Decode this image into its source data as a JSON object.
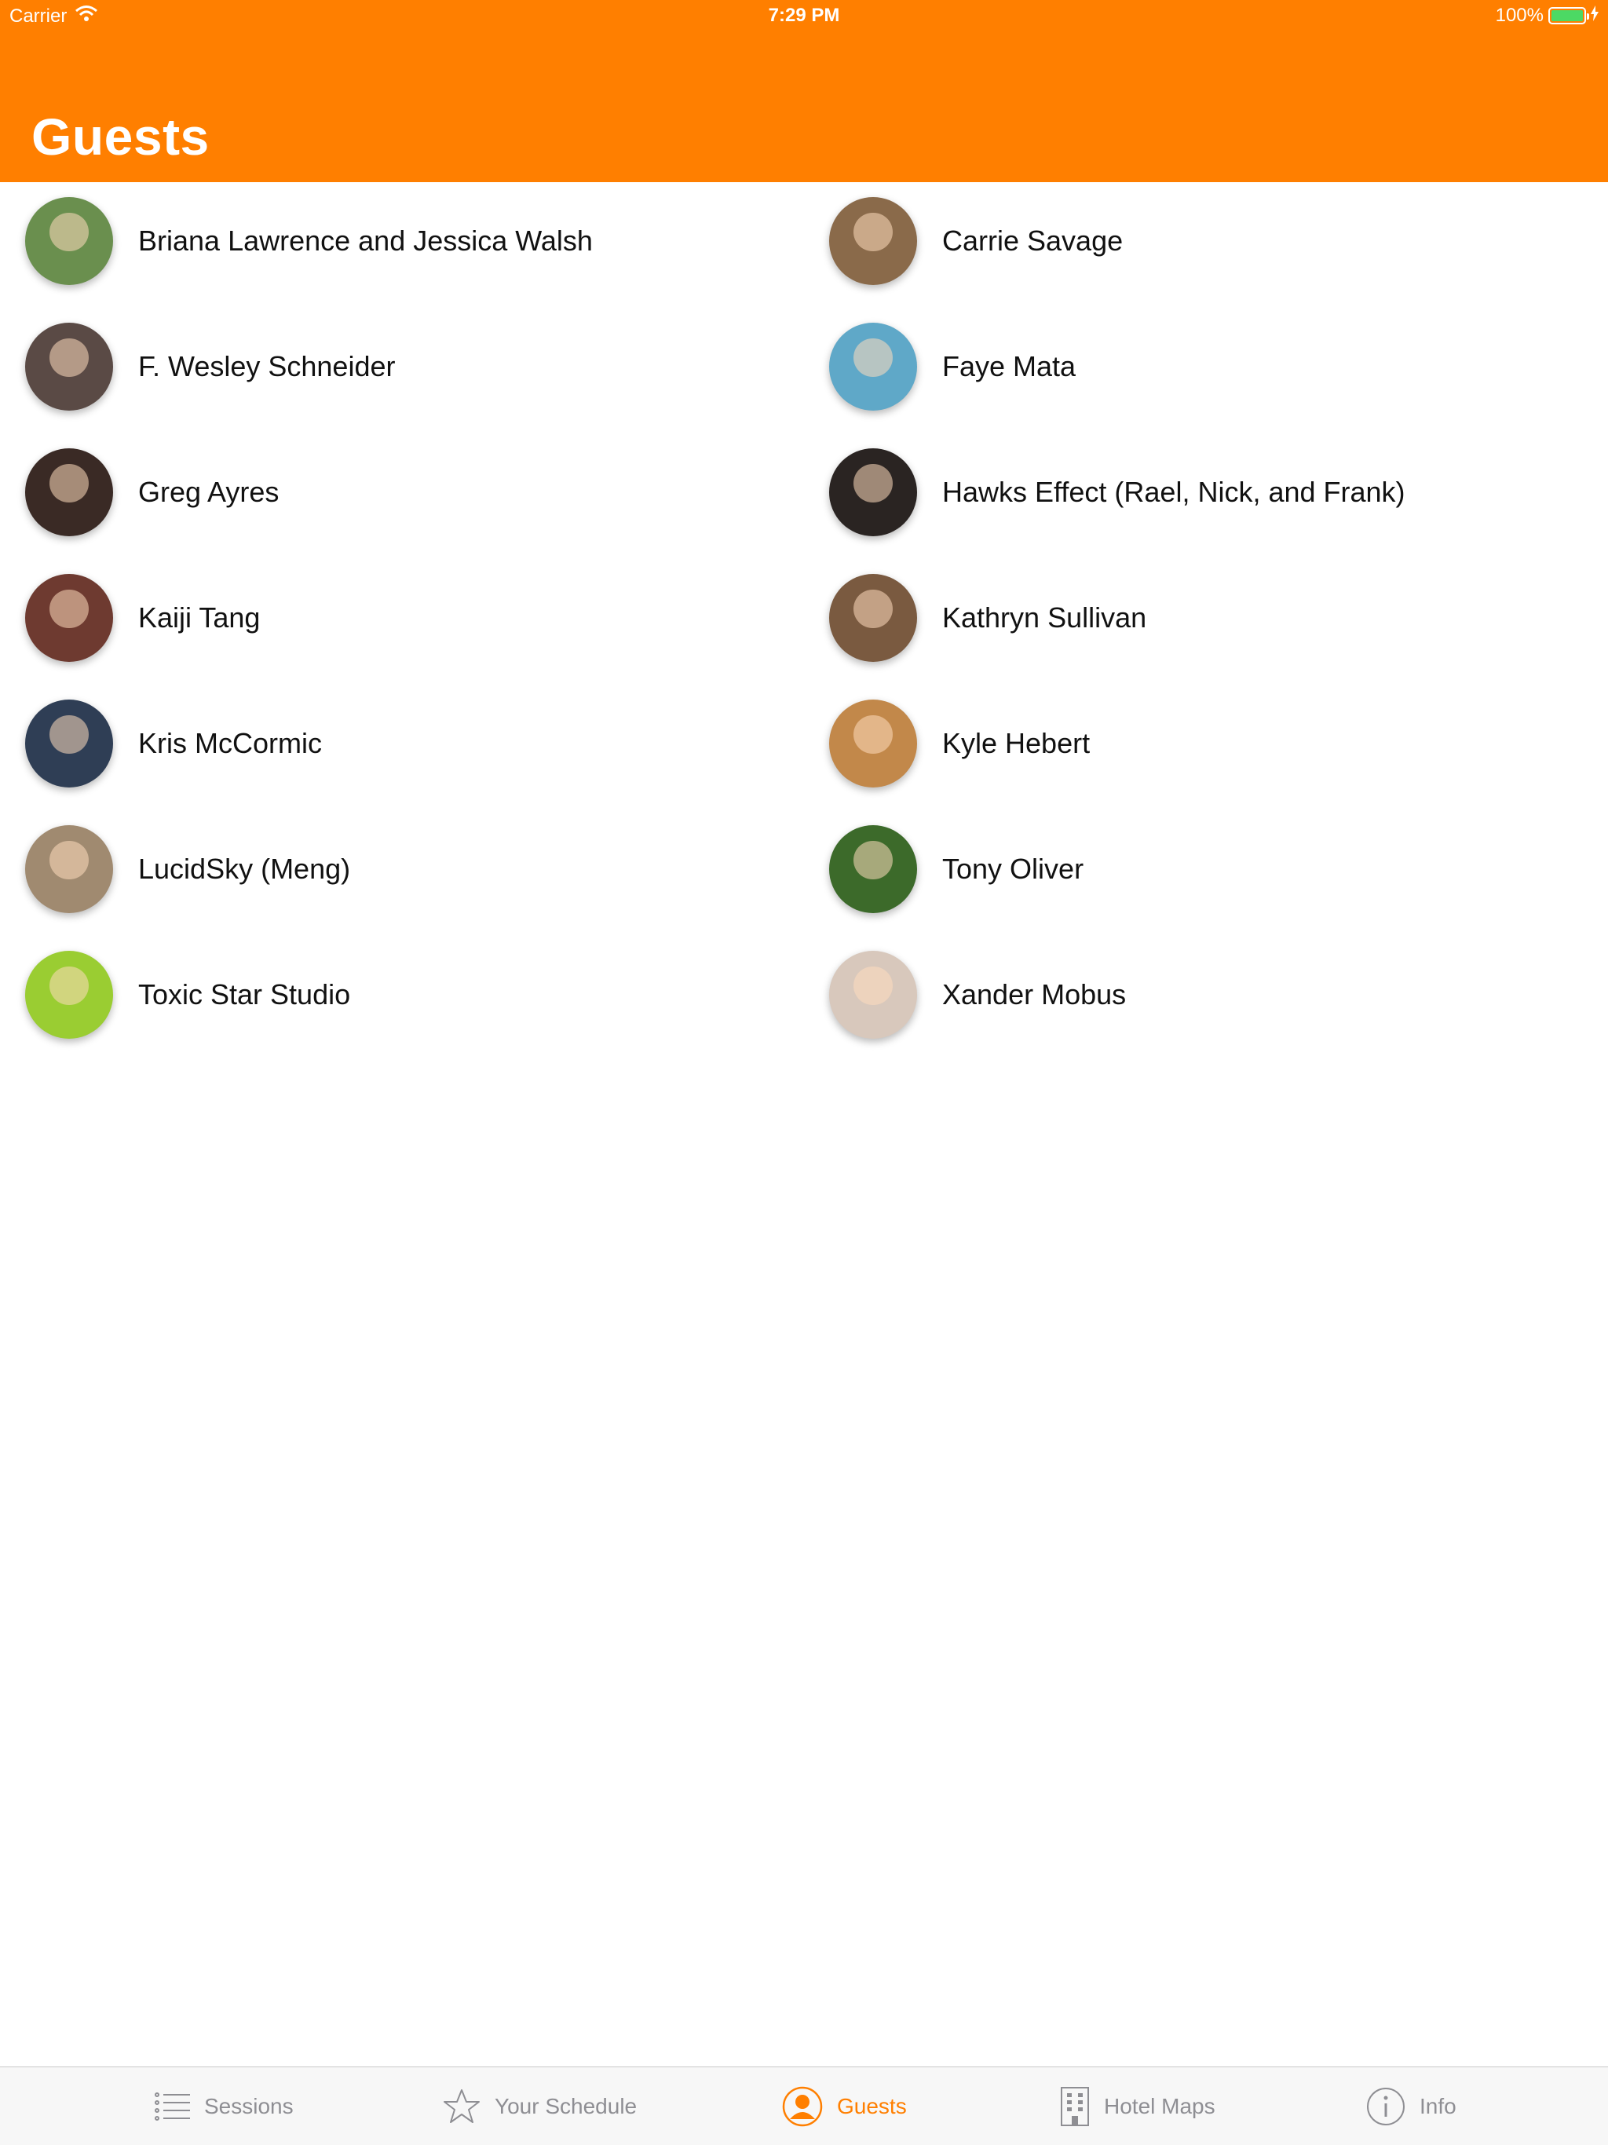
{
  "status_bar": {
    "carrier": "Carrier",
    "time": "7:29 PM",
    "battery": "100%"
  },
  "header": {
    "title": "Guests",
    "color": "#FF7F00"
  },
  "guests": [
    {
      "name": "Briana Lawrence and Jessica Walsh",
      "avatar_color": "#6a8f4e"
    },
    {
      "name": "Carrie Savage",
      "avatar_color": "#8a6a4a"
    },
    {
      "name": "F. Wesley Schneider",
      "avatar_color": "#5a4a45"
    },
    {
      "name": "Faye Mata",
      "avatar_color": "#5fa8c8"
    },
    {
      "name": "Greg Ayres",
      "avatar_color": "#3a2a25"
    },
    {
      "name": "Hawks Effect (Rael, Nick, and Frank)",
      "avatar_color": "#2a2422"
    },
    {
      "name": "Kaiji Tang",
      "avatar_color": "#6e3a30"
    },
    {
      "name": "Kathryn Sullivan",
      "avatar_color": "#7a5a40"
    },
    {
      "name": "Kris McCormic",
      "avatar_color": "#2f3e55"
    },
    {
      "name": "Kyle Hebert",
      "avatar_color": "#c2884a"
    },
    {
      "name": "LucidSky (Meng)",
      "avatar_color": "#a08a70"
    },
    {
      "name": "Tony Oliver",
      "avatar_color": "#3c6a2a"
    },
    {
      "name": "Toxic Star Studio",
      "avatar_color": "#9acd32"
    },
    {
      "name": "Xander Mobus",
      "avatar_color": "#d8c8bc"
    }
  ],
  "tabs": [
    {
      "label": "Sessions",
      "icon": "list-icon"
    },
    {
      "label": "Your Schedule",
      "icon": "star-icon"
    },
    {
      "label": "Guests",
      "icon": "person-icon",
      "active": true
    },
    {
      "label": "Hotel Maps",
      "icon": "building-icon"
    },
    {
      "label": "Info",
      "icon": "info-icon"
    }
  ],
  "colors": {
    "accent": "#FF7F00",
    "tab_inactive": "#8E8E93"
  }
}
